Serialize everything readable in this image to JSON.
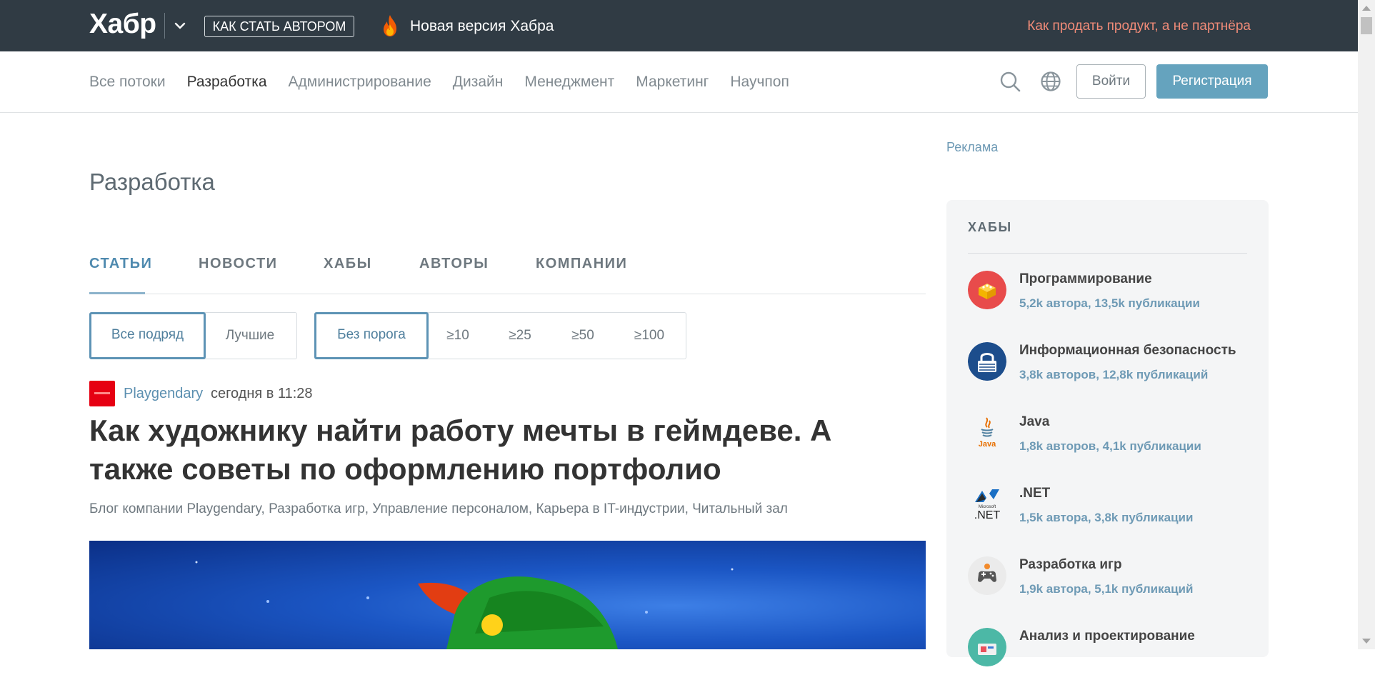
{
  "header": {
    "logo": "Хабр",
    "author_button": "КАК СТАТЬ АВТОРОМ",
    "new_version": "Новая версия Хабра",
    "promo_link": "Как продать продукт, а не партнёра"
  },
  "nav": {
    "items": [
      {
        "label": "Все потоки",
        "active": false
      },
      {
        "label": "Разработка",
        "active": true
      },
      {
        "label": "Администрирование",
        "active": false
      },
      {
        "label": "Дизайн",
        "active": false
      },
      {
        "label": "Менеджмент",
        "active": false
      },
      {
        "label": "Маркетинг",
        "active": false
      },
      {
        "label": "Научпоп",
        "active": false
      }
    ],
    "login": "Войти",
    "register": "Регистрация"
  },
  "page": {
    "title": "Разработка",
    "tabs": [
      "СТАТЬИ",
      "НОВОСТИ",
      "ХАБЫ",
      "АВТОРЫ",
      "КОМПАНИИ"
    ],
    "sort_filters": [
      "Все подряд",
      "Лучшие"
    ],
    "rating_filters": [
      "Без порога",
      "≥10",
      "≥25",
      "≥50",
      "≥100"
    ]
  },
  "article": {
    "company": "Playgendary",
    "time": "сегодня в 11:28",
    "title": "Как художнику найти работу мечты в геймдеве. А также советы по оформлению портфолио",
    "hubs": "Блог компании Playgendary,  Разработка игр,  Управление персоналом,  Карьера в IT-индустрии,  Читальный зал"
  },
  "sidebar": {
    "ad_label": "Реклама",
    "hubs_title": "ХАБЫ",
    "hubs": [
      {
        "name": "Программирование",
        "stats": "5,2k автора,  13,5k публикации",
        "icon": "programming-icon"
      },
      {
        "name": "Информационная безопасность",
        "stats": "3,8k авторов,  12,8k публикаций",
        "icon": "security-icon"
      },
      {
        "name": "Java",
        "stats": "1,8k авторов,  4,1k публикации",
        "icon": "java-icon"
      },
      {
        "name": ".NET",
        "stats": "1,5k автора,  3,8k публикации",
        "icon": "dotnet-icon"
      },
      {
        "name": "Разработка игр",
        "stats": "1,9k автора,  5,1k публикаций",
        "icon": "gamedev-icon"
      },
      {
        "name": "Анализ и проектирование",
        "stats": "",
        "icon": "analysis-icon"
      }
    ]
  },
  "colors": {
    "header_bg": "#303b44",
    "accent": "#65a3be",
    "promo": "#f08b78",
    "link": "#5b8fb0"
  }
}
